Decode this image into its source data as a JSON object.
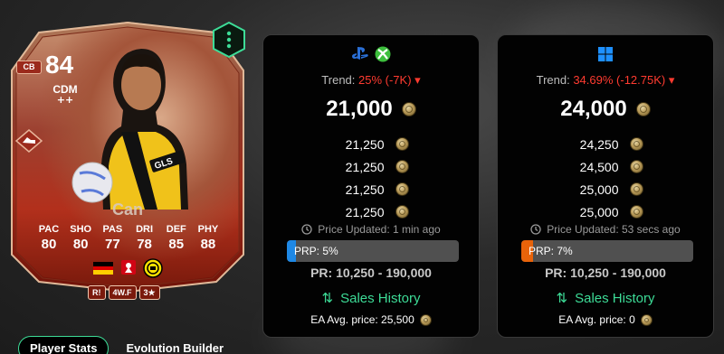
{
  "card": {
    "rating": "84",
    "position": "CDM",
    "plus": "++",
    "alt_position": "CB",
    "name": "Can",
    "stats": [
      {
        "label": "PAC",
        "value": "80"
      },
      {
        "label": "SHO",
        "value": "80"
      },
      {
        "label": "PAS",
        "value": "77"
      },
      {
        "label": "DRI",
        "value": "78"
      },
      {
        "label": "DEF",
        "value": "85"
      },
      {
        "label": "PHY",
        "value": "88"
      }
    ],
    "traits": [
      "R!",
      "4W.F",
      "3★"
    ],
    "menu_icon": "vertical-dots-icon"
  },
  "console_panel": {
    "platform_icons": [
      "playstation-icon",
      "xbox-icon"
    ],
    "trend_label": "Trend:",
    "trend_value": "25% (-7K)",
    "main_price": "21,000",
    "prices": [
      "21,250",
      "21,250",
      "21,250",
      "21,250"
    ],
    "updated": "Price Updated: 1 min ago",
    "prp_label": "PRP: 5%",
    "prp_fraction": 0.05,
    "prp_color": "#1e88e5",
    "price_range": "PR: 10,250 - 190,000",
    "sales_history": "Sales History",
    "ea_avg": "EA Avg. price: 25,500"
  },
  "pc_panel": {
    "platform_icons": [
      "windows-icon"
    ],
    "trend_label": "Trend:",
    "trend_value": "34.69% (-12.75K)",
    "main_price": "24,000",
    "prices": [
      "24,250",
      "24,500",
      "25,000",
      "25,000"
    ],
    "updated": "Price Updated: 53 secs ago",
    "prp_label": "PRP: 7%",
    "prp_fraction": 0.07,
    "prp_color": "#e8630a",
    "price_range": "PR: 10,250 - 190,000",
    "sales_history": "Sales History",
    "ea_avg": "EA Avg. price: 0"
  },
  "tabs": [
    {
      "label": "Player Stats",
      "active": true
    },
    {
      "label": "Evolution Builder",
      "active": false
    }
  ],
  "colors": {
    "accent_green": "#3ddc97",
    "trend_negative": "#ff3b30",
    "playstation": "#2a6fd6",
    "xbox": "#3dbf3d",
    "windows": "#1e90ff"
  }
}
